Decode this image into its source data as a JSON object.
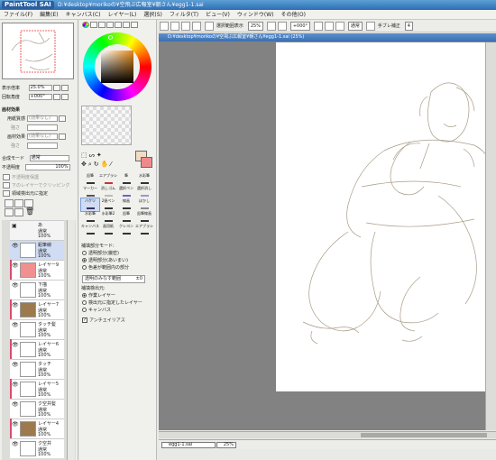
{
  "app": {
    "logo": "PaintTool SAI",
    "path": "D:¥desktop¥morikoの¥空飛ぶ広報室¥朝さん¥egg1-1.sai"
  },
  "menu": [
    "ファイル(F)",
    "編集(E)",
    "キャンバス(C)",
    "レイヤー(L)",
    "選択(S)",
    "フィルタ(T)",
    "ビュー(V)",
    "ウィンドウ(W)",
    "その他(O)"
  ],
  "toolbar": {
    "sel_label": "選択範囲表示",
    "zoom": "25%",
    "angle": "+000°",
    "mode": "通常",
    "stab_label": "手ブレ補正",
    "stab_value": "4"
  },
  "navigator": {
    "zoom_label": "表示倍率",
    "zoom_value": "25.0%",
    "angle_label": "回転角度",
    "angle_value": "+000°"
  },
  "paper": {
    "header": "画材効果",
    "rows": [
      {
        "label": "用紙質感",
        "value": "(効果なし)"
      },
      {
        "label": "強さ",
        "value": ""
      },
      {
        "label": "画材効果",
        "value": "(効果なし)"
      },
      {
        "label": "強さ",
        "value": ""
      }
    ]
  },
  "layer_props": {
    "blend_label": "合成モード",
    "blend_value": "通常",
    "opacity_label": "不透明度",
    "opacity_value": "100%",
    "protect": "不透明度保護",
    "clip": "下のレイヤーでクリッピング",
    "source": "領域検出元に指定"
  },
  "layers": [
    {
      "name": "あ",
      "mode": "通常",
      "opacity": "100%",
      "thumb": "#ffffff",
      "icon": "folder-icon",
      "red": false,
      "selected": false,
      "folder": true
    },
    {
      "name": "鉛筆線",
      "mode": "通常",
      "opacity": "100%",
      "thumb": "#ffffff",
      "icon": "eye-icon",
      "red": false,
      "selected": true
    },
    {
      "name": "レイヤー9",
      "mode": "通常",
      "opacity": "100%",
      "thumb": "#f09090",
      "icon": "eye-icon",
      "red": true,
      "selected": false
    },
    {
      "name": "下描",
      "mode": "通常",
      "opacity": "100%",
      "thumb": "#ffffff",
      "icon": "eye-icon",
      "red": false,
      "selected": false
    },
    {
      "name": "レイヤー7",
      "mode": "通常",
      "opacity": "100%",
      "thumb": "#9c7a4e",
      "icon": "eye-icon",
      "red": true,
      "selected": false
    },
    {
      "name": "タッチ髪",
      "mode": "通常",
      "opacity": "100%",
      "thumb": "#ffffff",
      "icon": "eye-icon",
      "red": false,
      "selected": false
    },
    {
      "name": "レイヤー6",
      "mode": "通常",
      "opacity": "100%",
      "thumb": "#ffffff",
      "icon": "eye-icon",
      "red": true,
      "selected": false
    },
    {
      "name": "タッチ",
      "mode": "通常",
      "opacity": "100%",
      "thumb": "#ffffff",
      "icon": "eye-icon",
      "red": false,
      "selected": false
    },
    {
      "name": "レイヤー5",
      "mode": "通常",
      "opacity": "100%",
      "thumb": "#ffffff",
      "icon": "eye-icon",
      "red": true,
      "selected": false
    },
    {
      "name": "ク空井髪",
      "mode": "通常",
      "opacity": "100%",
      "thumb": "#ffffff",
      "icon": "eye-icon",
      "red": false,
      "selected": false
    },
    {
      "name": "レイヤー4",
      "mode": "通常",
      "opacity": "100%",
      "thumb": "#9c7a4e",
      "icon": "eye-icon",
      "red": true,
      "selected": false
    },
    {
      "name": "ク空井",
      "mode": "通常",
      "opacity": "100%",
      "thumb": "#ffffff",
      "icon": "eye-icon",
      "red": false,
      "selected": false
    }
  ],
  "colors": {
    "primary": "#f2dcc4",
    "secondary": "#f08a8a",
    "accent": "#d84b6e"
  },
  "tools": [
    [
      "鉛筆",
      "エアブラシ",
      "筆",
      "水彩筆"
    ],
    [
      "マーカー",
      "消しゴム",
      "選択ペン",
      "選択消し"
    ],
    [
      "バケツ",
      "2値ペン",
      "線画",
      "ぼかし"
    ],
    [
      "水彩筆",
      "水彩筆2",
      "鉛筆",
      "鉛筆線画"
    ],
    [
      "キャンバス",
      "画用紙",
      "クレヨン",
      "エアブラシ"
    ]
  ],
  "tool_options": {
    "fill_mode_label": "補填部分モード:",
    "fill_modes": [
      "透明部分(厳密)",
      "透明部分(あいまい)",
      "色差が範囲内の部分"
    ],
    "fill_selected": 1,
    "range_label": "透明のみなす範囲",
    "range_value": "±0",
    "source_label": "補填検出元:",
    "sources": [
      "作業レイヤー",
      "検出元に指定したレイヤー",
      "キャンバス"
    ],
    "source_selected": 0,
    "antialias": "アンチエイリアス"
  },
  "document": {
    "title": "D:¥desktop¥morikoの¥空飛ぶ広報室¥朝さん¥egg1-1.sai (25%)",
    "file_tab": "egg1-1.sai",
    "zoom": "25%"
  }
}
